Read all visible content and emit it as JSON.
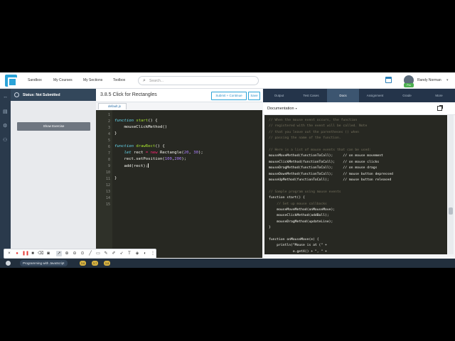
{
  "nav": {
    "links": [
      "Sandbox",
      "My Courses",
      "My Sections",
      "Toolbox"
    ],
    "search_placeholder": "Search...",
    "user_name": "Randy Norman",
    "badge": "Pro"
  },
  "status": {
    "label": "Status: Not Submitted",
    "show_exercise": "Show Exercise"
  },
  "editor": {
    "title": "3.8.5 Click for Rectangles",
    "submit_label": "Submit + Continue",
    "save_label": "Save",
    "file_tab": "default.js",
    "line_numbers": [
      "1",
      "2",
      "3",
      "4",
      "5",
      "6",
      "7",
      "8",
      "9",
      "10",
      "11",
      "12",
      "13",
      "14",
      "15"
    ]
  },
  "tabs": [
    "Output",
    "Test Cases",
    "Docs",
    "Assignment",
    "Grade",
    "More"
  ],
  "active_tab": "Docs",
  "docs": {
    "title": "Documentation",
    "lines": [
      "// When the mouse event occurs, the function",
      "// registered with the event will be called. Note",
      "// that you leave out the parentheses () when",
      "// passing the name of the function.",
      "",
      "// Here is a list of mouse events that can be used:",
      "mouseMoveMethod(functionToCall);     // on mouse movement",
      "mouseClickMethod(functionToCall);    // on mouse clicks",
      "mouseDragMethod(functionToCall);     // on mouse drags",
      "mouseDownMethod(functionToCall);     // mouse button depressed",
      "mouseUpMethod(functionToCall);       // mouse button released",
      "",
      "// Sample program using mouse events",
      "function start() {",
      "    // Set up mouse callbacks",
      "    mouseMoveMethod(onMouseMove);",
      "    mouseClickMethod(addBall);",
      "    mouseDragMethod(updateLine);",
      "}",
      "",
      "function onMouseMove(e) {",
      "    println(\"Mouse is at (\" +",
      "            e.getX() + \", \" +"
    ]
  },
  "taskbar": {
    "app_label": "Programming with JavaScript",
    "badges": [
      "3.6",
      "3.7",
      "3.8"
    ]
  },
  "colors": {
    "editor_bg": "#272822",
    "nav_dark": "#24344a",
    "accent": "#2aa3d8"
  }
}
